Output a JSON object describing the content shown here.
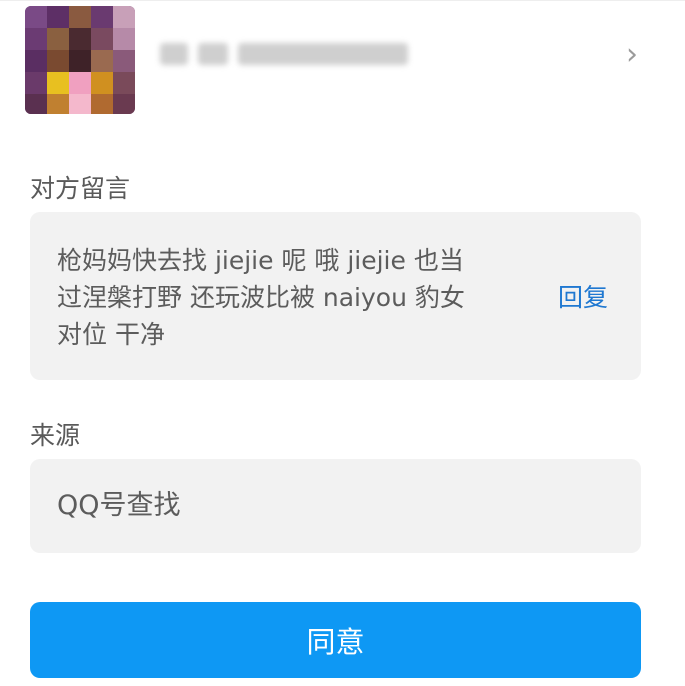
{
  "colors": {
    "accent": "#0e98f4",
    "link": "#1f78d1",
    "box_background": "#f2f2f2"
  },
  "profile": {
    "chevron_icon": "chevron-right-icon"
  },
  "message": {
    "label": "对方留言",
    "lines": [
      "枪妈妈快去找 jiejie 呢 哦 jiejie 也当",
      "过涅槃打野 还玩波比被 naiyou 豹女",
      "对位 干净"
    ],
    "reply_label": "回复"
  },
  "source": {
    "label": "来源",
    "value": "QQ号查找"
  },
  "actions": {
    "agree_label": "同意"
  }
}
